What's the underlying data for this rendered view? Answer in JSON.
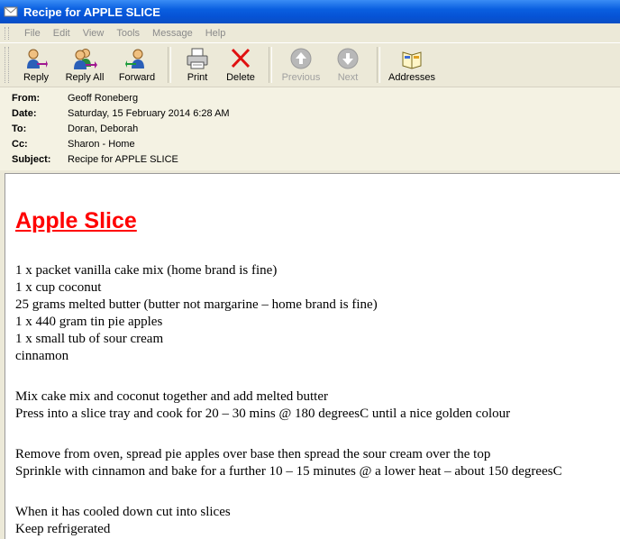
{
  "window": {
    "title": "Recipe for APPLE SLICE"
  },
  "menu": [
    "File",
    "Edit",
    "View",
    "Tools",
    "Message",
    "Help"
  ],
  "toolbar": {
    "reply": "Reply",
    "reply_all": "Reply All",
    "forward": "Forward",
    "print": "Print",
    "delete": "Delete",
    "previous": "Previous",
    "next": "Next",
    "addresses": "Addresses"
  },
  "headers": {
    "from_label": "From:",
    "from_value": "Geoff Roneberg",
    "date_label": "Date:",
    "date_value": "Saturday, 15 February 2014 6:28 AM",
    "to_label": "To:",
    "to_value": "Doran, Deborah",
    "cc_label": "Cc:",
    "cc_value": "Sharon - Home",
    "subject_label": "Subject:",
    "subject_value": "Recipe for APPLE SLICE"
  },
  "message": {
    "title": "Apple Slice",
    "ingredients": [
      "1 x packet vanilla cake mix   (home brand is fine)",
      "1 x cup coconut",
      "25 grams melted butter   (butter not margarine – home brand is fine)",
      "1 x 440 gram tin pie apples",
      "1 x small tub of sour cream",
      "cinnamon"
    ],
    "step1": [
      "Mix cake mix and coconut together and add melted butter",
      "Press into a slice tray and cook for 20 – 30 mins @ 180 degreesC until a nice golden colour"
    ],
    "step2": [
      "Remove from oven, spread pie apples over base then spread the sour cream over the top",
      "Sprinkle with cinnamon and bake for a further 10 – 15 minutes @ a lower heat – about 150 degreesC"
    ],
    "step3": [
      "When it has cooled down cut into slices",
      "Keep refrigerated"
    ]
  }
}
